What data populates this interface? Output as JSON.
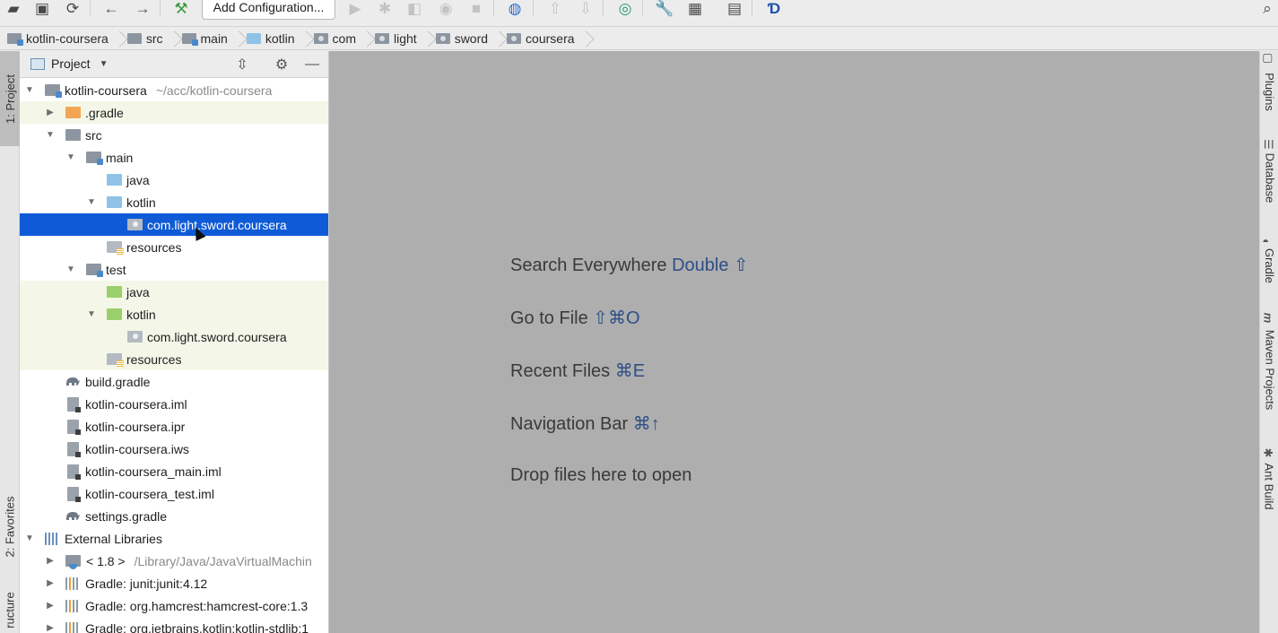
{
  "toolbar": {
    "add_configuration_label": "Add Configuration...",
    "icons": [
      "open-icon",
      "save-icon",
      "sync-icon",
      "back-icon",
      "forward-icon",
      "build-icon",
      "run-icon",
      "debug-icon",
      "coverage-icon",
      "profile-icon",
      "stop-icon",
      "update-icon",
      "vcs-icon",
      "vcs-update-icon",
      "project-structure-icon",
      "settings-icon",
      "sdk-icon",
      "terminal-icon",
      "plugin-icon",
      "search-icon"
    ]
  },
  "breadcrumb": [
    {
      "label": "kotlin-coursera",
      "icon": "module-folder-icon"
    },
    {
      "label": "src",
      "icon": "folder-icon"
    },
    {
      "label": "main",
      "icon": "module-folder-icon"
    },
    {
      "label": "kotlin",
      "icon": "source-folder-icon"
    },
    {
      "label": "com",
      "icon": "package-icon"
    },
    {
      "label": "light",
      "icon": "package-icon"
    },
    {
      "label": "sword",
      "icon": "package-icon"
    },
    {
      "label": "coursera",
      "icon": "package-icon"
    }
  ],
  "left_strip": {
    "project_tab": "1: Project",
    "favorites_tab": "2: Favorites",
    "structure_tab": "ructure"
  },
  "right_strip": {
    "plugins_tab": "Plugins",
    "database_tab": "Database",
    "gradle_tab": "Gradle",
    "maven_tab": "Maven Projects",
    "maven_icon_letter": "m",
    "ant_tab": "Ant Build"
  },
  "project_panel": {
    "title": "Project",
    "tree": {
      "root": {
        "label": "kotlin-coursera",
        "path": "~/acc/kotlin-coursera"
      },
      "gradle_dir": ".gradle",
      "src": "src",
      "main": "main",
      "main_java": "java",
      "main_kotlin": "kotlin",
      "main_pkg": "com.light.sword.coursera",
      "main_resources": "resources",
      "test": "test",
      "test_java": "java",
      "test_kotlin": "kotlin",
      "test_pkg": "com.light.sword.coursera",
      "test_resources": "resources",
      "build_gradle": "build.gradle",
      "iml": "kotlin-coursera.iml",
      "ipr": "kotlin-coursera.ipr",
      "iws": "kotlin-coursera.iws",
      "main_iml": "kotlin-coursera_main.iml",
      "test_iml": "kotlin-coursera_test.iml",
      "settings_gradle": "settings.gradle",
      "external_libraries": "External Libraries",
      "jdk": {
        "label": "< 1.8 >",
        "path": "/Library/Java/JavaVirtualMachin"
      },
      "lib_junit": "Gradle: junit:junit:4.12",
      "lib_hamcrest": "Gradle: org.hamcrest:hamcrest-core:1.3",
      "lib_kotlin": "Gradle: org.jetbrains.kotlin:kotlin-stdlib:1"
    }
  },
  "editor": {
    "hints": [
      {
        "text": "Search Everywhere",
        "shortcut": "Double ⇧"
      },
      {
        "text": "Go to File",
        "shortcut": "⇧⌘O"
      },
      {
        "text": "Recent Files",
        "shortcut": "⌘E"
      },
      {
        "text": "Navigation Bar",
        "shortcut": "⌘↑"
      },
      {
        "text": "Drop files here to open",
        "shortcut": ""
      }
    ]
  },
  "colors": {
    "selection": "#0f5bd7",
    "editor_bg": "#aeaeae",
    "shortcut": "#2e4f86",
    "test_highlight": "#f4f7e8"
  }
}
